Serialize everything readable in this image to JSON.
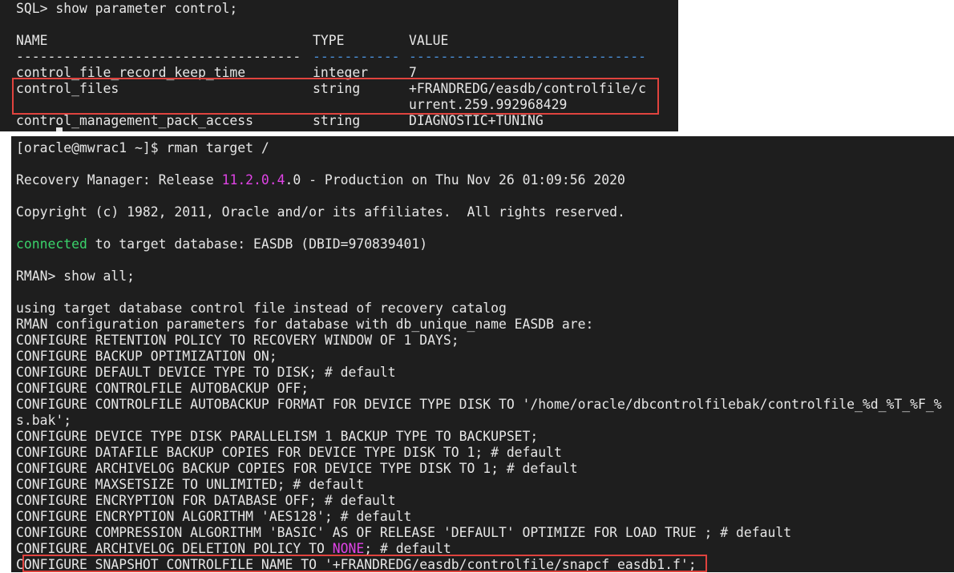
{
  "sql_terminal": {
    "prompt_line": "SQL> show parameter control;",
    "headers": {
      "name": "NAME",
      "type": "TYPE",
      "value": "VALUE"
    },
    "separator": {
      "name": "------------------------------------",
      "type": "-----------",
      "value": "------------------------------"
    },
    "rows": [
      {
        "name": "control_file_record_keep_time",
        "type": "integer",
        "value": "7",
        "value_cont": ""
      },
      {
        "name": "control_files",
        "type": "string",
        "value": "+FRANDREDG/easdb/controlfile/c",
        "value_cont": "urrent.259.992968429"
      },
      {
        "name": "control_management_pack_access",
        "type": "string",
        "value": "DIAGNOSTIC+TUNING",
        "value_cont": ""
      }
    ]
  },
  "rman_terminal": {
    "shell_prompt": "[oracle@mwrac1 ~]$ rman target /",
    "banner": {
      "prefix": "Recovery Manager: Release ",
      "version": "11.2.0.4",
      "suffix": ".0 - Production on Thu Nov 26 01:09:56 2020"
    },
    "copyright": "Copyright (c) 1982, 2011, Oracle and/or its affiliates.  All rights reserved.",
    "connected": {
      "word": "connected",
      "rest": " to target database: EASDB (DBID=970839401)"
    },
    "rman_prompt": "RMAN> show all;",
    "output": [
      "using target database control file instead of recovery catalog",
      "RMAN configuration parameters for database with db_unique_name EASDB are:",
      "CONFIGURE RETENTION POLICY TO RECOVERY WINDOW OF 1 DAYS;",
      "CONFIGURE BACKUP OPTIMIZATION ON;",
      "CONFIGURE DEFAULT DEVICE TYPE TO DISK; # default",
      "CONFIGURE CONTROLFILE AUTOBACKUP OFF;",
      "CONFIGURE CONTROLFILE AUTOBACKUP FORMAT FOR DEVICE TYPE DISK TO '/home/oracle/dbcontrolfilebak/controlfile_%d_%T_%F_%",
      "s.bak';",
      "CONFIGURE DEVICE TYPE DISK PARALLELISM 1 BACKUP TYPE TO BACKUPSET;",
      "CONFIGURE DATAFILE BACKUP COPIES FOR DEVICE TYPE DISK TO 1; # default",
      "CONFIGURE ARCHIVELOG BACKUP COPIES FOR DEVICE TYPE DISK TO 1; # default",
      "CONFIGURE MAXSETSIZE TO UNLIMITED; # default",
      "CONFIGURE ENCRYPTION FOR DATABASE OFF; # default",
      "CONFIGURE ENCRYPTION ALGORITHM 'AES128'; # default",
      "CONFIGURE COMPRESSION ALGORITHM 'BASIC' AS OF RELEASE 'DEFAULT' OPTIMIZE FOR LOAD TRUE ; # default"
    ],
    "deletion_policy": {
      "prefix": "CONFIGURE ARCHIVELOG DELETION POLICY TO ",
      "keyword": "NONE",
      "suffix": "; # default"
    },
    "snapshot_line": "CONFIGURE SNAPSHOT CONTROLFILE NAME TO '+FRANDREDG/easdb/controlfile/snapcf_easdb1.f';"
  },
  "colors": {
    "terminal_bg": "#1e1e1e",
    "text": "#e6e6e6",
    "highlight_box": "#e0433e",
    "connected_green": "#3ad26a",
    "keyword_magenta": "#e043e6",
    "separator_blue": "#4a90d9"
  }
}
